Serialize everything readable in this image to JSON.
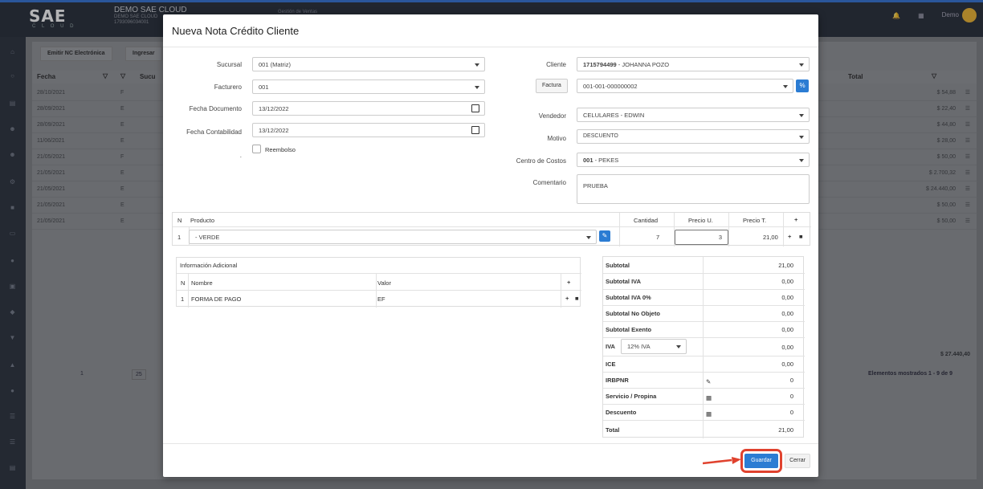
{
  "app": {
    "logo": "SAE",
    "logo_sub": "C L O U D",
    "company_name": "DEMO SAE CLOUD",
    "company_sub1": "DEMO SAE CLOUD",
    "company_sub2": "1793096034001",
    "module": "Gestión de Ventas",
    "user": "Demo"
  },
  "toolbar": {
    "emit_label": "Emitir NC Electrónica",
    "ingresar_label": "Ingresar"
  },
  "bg_table": {
    "headers": {
      "fecha": "Fecha",
      "sucursal": "Sucu",
      "total": "Total"
    },
    "rows": [
      {
        "fecha": "28/10/2021",
        "tipo": "F",
        "total": "$ 54,88"
      },
      {
        "fecha": "28/09/2021",
        "tipo": "E",
        "total": "$ 22,40"
      },
      {
        "fecha": "28/09/2021",
        "tipo": "E",
        "total": "$ 44,80"
      },
      {
        "fecha": "11/06/2021",
        "tipo": "E",
        "total": "$ 28,00"
      },
      {
        "fecha": "21/05/2021",
        "tipo": "F",
        "total": "$ 50,00"
      },
      {
        "fecha": "21/05/2021",
        "tipo": "E",
        "total": "$ 2.700,32"
      },
      {
        "fecha": "21/05/2021",
        "tipo": "E",
        "total": "$ 24.440,00"
      },
      {
        "fecha": "21/05/2021",
        "tipo": "E",
        "total": "$ 50,00"
      },
      {
        "fecha": "21/05/2021",
        "tipo": "E",
        "total": "$ 50,00"
      }
    ],
    "grand_total": "$ 27.440,40",
    "page": "1",
    "page_size": "25",
    "shown": "Elementos mostrados 1 - 9 de 9"
  },
  "modal": {
    "title": "Nueva Nota Crédito Cliente",
    "left": {
      "sucursal_label": "Sucursal",
      "sucursal_value": "001 (Matriz)",
      "facturero_label": "Facturero",
      "facturero_value": "001",
      "fecha_doc_label": "Fecha Documento",
      "fecha_doc_value": "13/12/2022",
      "fecha_cont_label": "Fecha Contabilidad",
      "fecha_cont_value": "13/12/2022",
      "reembolso_label": "Reembolso",
      "dot": "."
    },
    "right": {
      "cliente_label": "Cliente",
      "cliente_id": "1715794499",
      "cliente_name": " - JOHANNA POZO",
      "factura_label": "Factura",
      "factura_value": "001-001-000000002",
      "vendedor_label": "Vendedor",
      "vendedor_value": "CELULARES - EDWIN",
      "motivo_label": "Motivo",
      "motivo_value": "DESCUENTO",
      "centro_label": "Centro de Costos",
      "centro_code": "001",
      "centro_name": " - PEKES",
      "comentario_label": "Comentario",
      "comentario_value": "PRUEBA"
    },
    "products": {
      "headers": {
        "n": "N",
        "producto": "Producto",
        "cantidad": "Cantidad",
        "precio_u": "Precio U.",
        "precio_t": "Precio T.",
        "add": "+"
      },
      "rows": [
        {
          "n": "1",
          "producto": " - VERDE",
          "cantidad": "7",
          "precio_u": "3",
          "precio_t": "21,00"
        }
      ]
    },
    "info": {
      "title": "Información Adicional",
      "headers": {
        "n": "N",
        "nombre": "Nombre",
        "valor": "Valor",
        "add": "+"
      },
      "rows": [
        {
          "n": "1",
          "nombre": "FORMA DE PAGO",
          "valor": "EF"
        }
      ]
    },
    "totals": {
      "subtotal_label": "Subtotal",
      "subtotal": "21,00",
      "subtotal_iva_label": "Subtotal IVA",
      "subtotal_iva": "0,00",
      "subtotal_iva0_label": "Subtotal IVA 0%",
      "subtotal_iva0": "0,00",
      "no_objeto_label": "Subtotal No Objeto",
      "no_objeto": "0,00",
      "exento_label": "Subtotal Exento",
      "exento": "0,00",
      "iva_label": "IVA",
      "iva_select": "12% IVA",
      "iva": "0,00",
      "ice_label": "ICE",
      "ice": "0,00",
      "irbpnr_label": "IRBPNR",
      "irbpnr": "0",
      "servicio_label": "Servicio / Propina",
      "servicio": "0",
      "descuento_label": "Descuento",
      "descuento": "0",
      "total_label": "Total",
      "total": "21,00"
    },
    "buttons": {
      "guardar": "Guardar",
      "cerrar": "Cerrar"
    }
  },
  "colors": {
    "primary": "#2b7cd3",
    "highlight": "#e0422e",
    "topbar": "#1e2530"
  }
}
